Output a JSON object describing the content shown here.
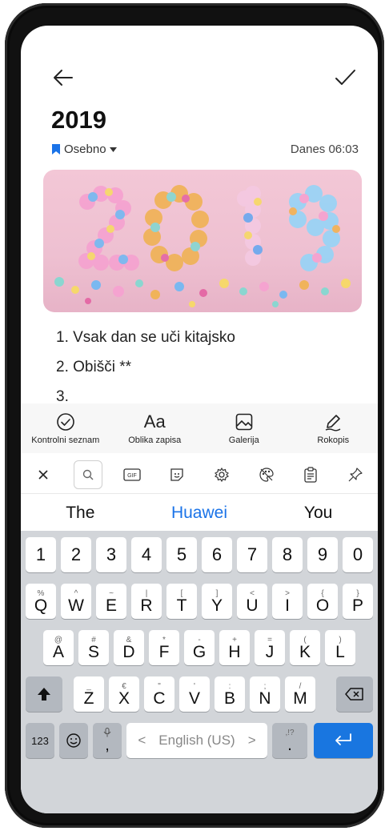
{
  "note": {
    "title": "2019",
    "category": "Osebno",
    "date": "Danes 06:03",
    "lines": [
      "1. Vsak dan se uči kitajsko",
      "2. Obišči **",
      "3."
    ]
  },
  "toolbar": {
    "checklist_label": "Kontrolni seznam",
    "format_label": "Oblika zapisa",
    "format_glyph": "Aa",
    "gallery_label": "Galerija",
    "handwriting_label": "Rokopis"
  },
  "suggestions": [
    "The",
    "Huawei",
    "You"
  ],
  "keyboard": {
    "numbers": [
      "1",
      "2",
      "3",
      "4",
      "5",
      "6",
      "7",
      "8",
      "9",
      "0"
    ],
    "row1": [
      {
        "k": "Q",
        "s": "%"
      },
      {
        "k": "W",
        "s": "^"
      },
      {
        "k": "E",
        "s": "~"
      },
      {
        "k": "R",
        "s": "|"
      },
      {
        "k": "T",
        "s": "["
      },
      {
        "k": "Y",
        "s": "]"
      },
      {
        "k": "U",
        "s": "<"
      },
      {
        "k": "I",
        "s": ">"
      },
      {
        "k": "O",
        "s": "{"
      },
      {
        "k": "P",
        "s": "}"
      }
    ],
    "row2": [
      {
        "k": "A",
        "s": "@"
      },
      {
        "k": "S",
        "s": "#"
      },
      {
        "k": "D",
        "s": "&"
      },
      {
        "k": "F",
        "s": "*"
      },
      {
        "k": "G",
        "s": "-"
      },
      {
        "k": "H",
        "s": "+"
      },
      {
        "k": "J",
        "s": "="
      },
      {
        "k": "K",
        "s": "("
      },
      {
        "k": "L",
        "s": ")"
      }
    ],
    "row3": [
      {
        "k": "Z",
        "s": "_"
      },
      {
        "k": "X",
        "s": "€"
      },
      {
        "k": "C",
        "s": "\""
      },
      {
        "k": "V",
        "s": "'"
      },
      {
        "k": "B",
        "s": ":"
      },
      {
        "k": "N",
        "s": ";"
      },
      {
        "k": "M",
        "s": "/"
      }
    ],
    "num_label": "123",
    "comma_label": ",",
    "space_label": "English (US)",
    "period_label": ".",
    "period_sup": ",!?",
    "space_left": "<",
    "space_right": ">"
  },
  "colors": {
    "accent": "#1976e0",
    "bookmark": "#1a73e8",
    "suggestion_highlight": "#1a73e8"
  }
}
